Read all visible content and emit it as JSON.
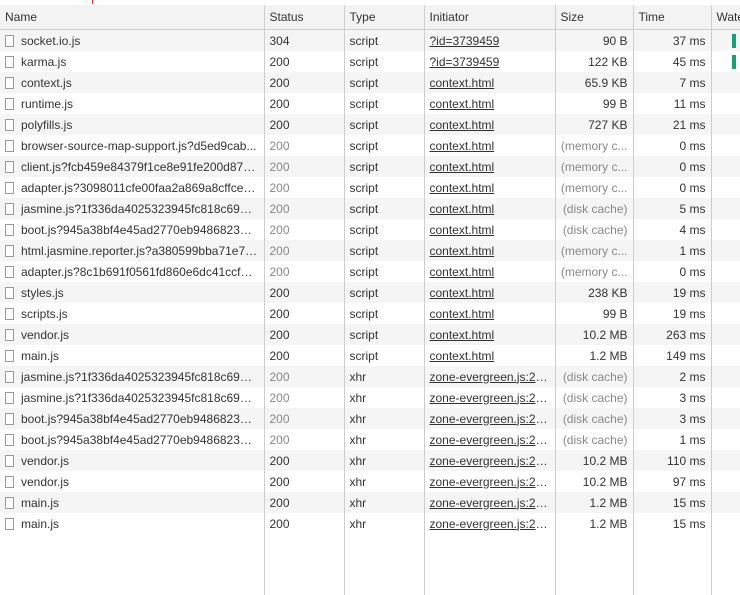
{
  "columns": {
    "name": "Name",
    "status": "Status",
    "type": "Type",
    "initiator": "Initiator",
    "size": "Size",
    "time": "Time",
    "waterfall": "Waterfall"
  },
  "rows": [
    {
      "name": "socket.io.js",
      "status": "304",
      "type": "script",
      "initiator": "?id=3739459",
      "size": "90 B",
      "time": "37 ms",
      "wf": "teal"
    },
    {
      "name": "karma.js",
      "status": "200",
      "type": "script",
      "initiator": "?id=3739459",
      "size": "122 KB",
      "time": "45 ms",
      "wf": "teal"
    },
    {
      "name": "context.js",
      "status": "200",
      "type": "script",
      "initiator": "context.html",
      "size": "65.9 KB",
      "time": "7 ms"
    },
    {
      "name": "runtime.js",
      "status": "200",
      "type": "script",
      "initiator": "context.html",
      "size": "99 B",
      "time": "11 ms"
    },
    {
      "name": "polyfills.js",
      "status": "200",
      "type": "script",
      "initiator": "context.html",
      "size": "727 KB",
      "time": "21 ms"
    },
    {
      "name": "browser-source-map-support.js?d5ed9cab...",
      "status": "200",
      "type": "script",
      "initiator": "context.html",
      "size": "(memory c...",
      "time": "0 ms",
      "dim": true
    },
    {
      "name": "client.js?fcb459e84379f1ce8e91fe200d874...",
      "status": "200",
      "type": "script",
      "initiator": "context.html",
      "size": "(memory c...",
      "time": "0 ms",
      "dim": true
    },
    {
      "name": "adapter.js?3098011cfe00faa2a869a8cffce1...",
      "status": "200",
      "type": "script",
      "initiator": "context.html",
      "size": "(memory c...",
      "time": "0 ms",
      "dim": true
    },
    {
      "name": "jasmine.js?1f336da4025323945fc818c69bd...",
      "status": "200",
      "type": "script",
      "initiator": "context.html",
      "size": "(disk cache)",
      "time": "5 ms",
      "dim": true
    },
    {
      "name": "boot.js?945a38bf4e45ad2770eb948682319...",
      "status": "200",
      "type": "script",
      "initiator": "context.html",
      "size": "(disk cache)",
      "time": "4 ms",
      "dim": true
    },
    {
      "name": "html.jasmine.reporter.js?a380599bba71e79...",
      "status": "200",
      "type": "script",
      "initiator": "context.html",
      "size": "(memory c...",
      "time": "1 ms",
      "dim": true
    },
    {
      "name": "adapter.js?8c1b691f0561fd860e6dc41ccfa8...",
      "status": "200",
      "type": "script",
      "initiator": "context.html",
      "size": "(memory c...",
      "time": "0 ms",
      "dim": true
    },
    {
      "name": "styles.js",
      "status": "200",
      "type": "script",
      "initiator": "context.html",
      "size": "238 KB",
      "time": "19 ms"
    },
    {
      "name": "scripts.js",
      "status": "200",
      "type": "script",
      "initiator": "context.html",
      "size": "99 B",
      "time": "19 ms"
    },
    {
      "name": "vendor.js",
      "status": "200",
      "type": "script",
      "initiator": "context.html",
      "size": "10.2 MB",
      "time": "263 ms"
    },
    {
      "name": "main.js",
      "status": "200",
      "type": "script",
      "initiator": "context.html",
      "size": "1.2 MB",
      "time": "149 ms"
    },
    {
      "name": "jasmine.js?1f336da4025323945fc818c69bd...",
      "status": "200",
      "type": "xhr",
      "initiator": "zone-evergreen.js:29...",
      "size": "(disk cache)",
      "time": "2 ms",
      "dim": true
    },
    {
      "name": "jasmine.js?1f336da4025323945fc818c69bd...",
      "status": "200",
      "type": "xhr",
      "initiator": "zone-evergreen.js:29...",
      "size": "(disk cache)",
      "time": "3 ms",
      "dim": true
    },
    {
      "name": "boot.js?945a38bf4e45ad2770eb948682319...",
      "status": "200",
      "type": "xhr",
      "initiator": "zone-evergreen.js:29...",
      "size": "(disk cache)",
      "time": "3 ms",
      "dim": true
    },
    {
      "name": "boot.js?945a38bf4e45ad2770eb948682319...",
      "status": "200",
      "type": "xhr",
      "initiator": "zone-evergreen.js:29...",
      "size": "(disk cache)",
      "time": "1 ms",
      "dim": true
    },
    {
      "name": "vendor.js",
      "status": "200",
      "type": "xhr",
      "initiator": "zone-evergreen.js:29...",
      "size": "10.2 MB",
      "time": "110 ms"
    },
    {
      "name": "vendor.js",
      "status": "200",
      "type": "xhr",
      "initiator": "zone-evergreen.js:29...",
      "size": "10.2 MB",
      "time": "97 ms"
    },
    {
      "name": "main.js",
      "status": "200",
      "type": "xhr",
      "initiator": "zone-evergreen.js:29...",
      "size": "1.2 MB",
      "time": "15 ms"
    },
    {
      "name": "main.js",
      "status": "200",
      "type": "xhr",
      "initiator": "zone-evergreen.js:29...",
      "size": "1.2 MB",
      "time": "15 ms"
    }
  ],
  "colors": {
    "waterfall_teal": "#1a9e7a",
    "header_bg": "#f3f3f3",
    "row_alt_bg": "#f5f5f5",
    "grid_line": "#cdcdcd"
  }
}
